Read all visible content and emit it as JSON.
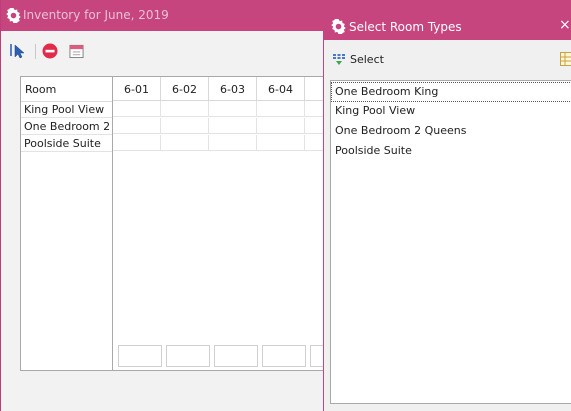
{
  "main_window": {
    "title": "Inventory for June, 2019",
    "toolbar": [
      "select-pointer-icon",
      "delete-icon",
      "calendar-icon"
    ]
  },
  "rooms": {
    "header": "Room",
    "items": [
      "King Pool View",
      "One Bedroom 2",
      "Poolside Suite"
    ]
  },
  "calendar": {
    "days": [
      "6-01",
      "6-02",
      "6-03",
      "6-04"
    ]
  },
  "dialog": {
    "title": "Select Room Types",
    "close": "×",
    "select_label": "Select",
    "items": [
      "One Bedroom King",
      "King Pool View",
      "One Bedroom 2 Queens",
      "Poolside Suite"
    ]
  },
  "colors": {
    "titlebar": "#c6457f",
    "accent": "#c03c78"
  }
}
